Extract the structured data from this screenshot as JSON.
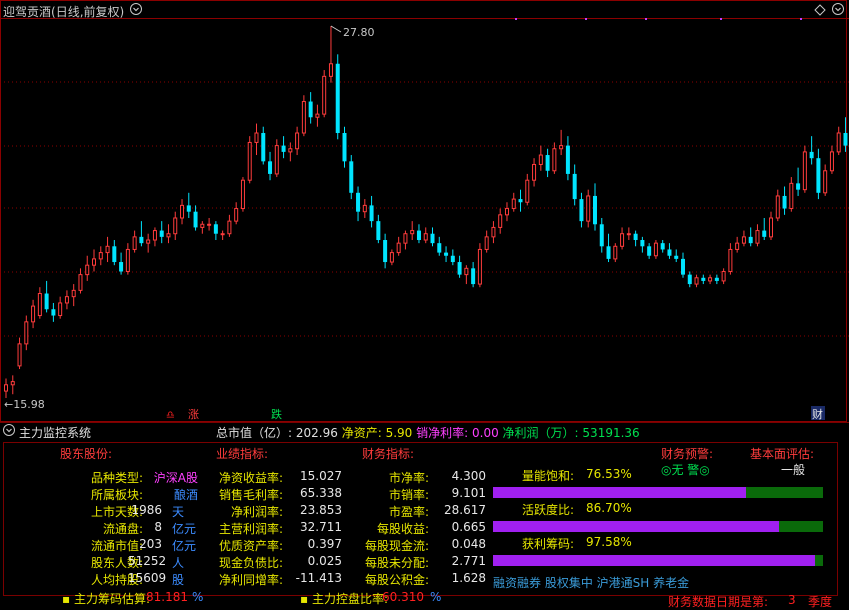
{
  "title": {
    "name": "迎驾贡酒",
    "mode": "(日线,前复权)"
  },
  "icons": {
    "dropdown": "chevron-down-icon",
    "diamond": "diamond-icon",
    "settings": "settings-icon"
  },
  "chart_data": {
    "type": "candlestick",
    "high_label": "27.80",
    "low_label": "15.98",
    "candles": [
      {
        "o": 16.2,
        "h": 16.6,
        "l": 15.98,
        "c": 16.4
      },
      {
        "o": 16.4,
        "h": 16.7,
        "l": 16.1,
        "c": 16.5
      },
      {
        "o": 17.0,
        "h": 17.9,
        "l": 16.9,
        "c": 17.7
      },
      {
        "o": 17.7,
        "h": 18.6,
        "l": 17.5,
        "c": 18.4
      },
      {
        "o": 18.4,
        "h": 19.1,
        "l": 18.2,
        "c": 18.9
      },
      {
        "o": 18.6,
        "h": 19.5,
        "l": 18.5,
        "c": 19.3
      },
      {
        "o": 19.3,
        "h": 19.7,
        "l": 18.7,
        "c": 18.8
      },
      {
        "o": 18.8,
        "h": 19.0,
        "l": 18.4,
        "c": 18.6
      },
      {
        "o": 18.6,
        "h": 19.2,
        "l": 18.5,
        "c": 19.0
      },
      {
        "o": 19.0,
        "h": 19.4,
        "l": 18.8,
        "c": 19.2
      },
      {
        "o": 19.2,
        "h": 19.6,
        "l": 18.9,
        "c": 19.4
      },
      {
        "o": 19.4,
        "h": 20.1,
        "l": 19.3,
        "c": 19.9
      },
      {
        "o": 19.9,
        "h": 20.5,
        "l": 19.7,
        "c": 20.2
      },
      {
        "o": 20.2,
        "h": 20.7,
        "l": 20.0,
        "c": 20.4
      },
      {
        "o": 20.4,
        "h": 20.8,
        "l": 20.2,
        "c": 20.6
      },
      {
        "o": 20.6,
        "h": 21.1,
        "l": 20.3,
        "c": 20.8
      },
      {
        "o": 20.8,
        "h": 21.0,
        "l": 20.2,
        "c": 20.3
      },
      {
        "o": 20.3,
        "h": 20.6,
        "l": 19.9,
        "c": 20.0
      },
      {
        "o": 20.0,
        "h": 20.9,
        "l": 19.9,
        "c": 20.7
      },
      {
        "o": 20.7,
        "h": 21.3,
        "l": 20.6,
        "c": 21.1
      },
      {
        "o": 21.1,
        "h": 21.6,
        "l": 20.8,
        "c": 20.9
      },
      {
        "o": 20.9,
        "h": 21.2,
        "l": 20.6,
        "c": 21.0
      },
      {
        "o": 21.0,
        "h": 21.4,
        "l": 20.8,
        "c": 21.3
      },
      {
        "o": 21.3,
        "h": 21.6,
        "l": 20.9,
        "c": 21.1
      },
      {
        "o": 21.1,
        "h": 21.5,
        "l": 20.9,
        "c": 21.2
      },
      {
        "o": 21.2,
        "h": 21.9,
        "l": 21.0,
        "c": 21.7
      },
      {
        "o": 21.7,
        "h": 22.3,
        "l": 21.5,
        "c": 22.1
      },
      {
        "o": 22.1,
        "h": 22.5,
        "l": 21.7,
        "c": 21.9
      },
      {
        "o": 21.9,
        "h": 22.1,
        "l": 21.3,
        "c": 21.4
      },
      {
        "o": 21.4,
        "h": 21.6,
        "l": 21.2,
        "c": 21.5
      },
      {
        "o": 21.5,
        "h": 21.7,
        "l": 21.3,
        "c": 21.5
      },
      {
        "o": 21.5,
        "h": 21.6,
        "l": 21.0,
        "c": 21.2
      },
      {
        "o": 21.2,
        "h": 21.3,
        "l": 21.0,
        "c": 21.2
      },
      {
        "o": 21.2,
        "h": 21.8,
        "l": 21.1,
        "c": 21.6
      },
      {
        "o": 21.6,
        "h": 22.2,
        "l": 21.5,
        "c": 22.0
      },
      {
        "o": 22.0,
        "h": 23.0,
        "l": 21.9,
        "c": 22.9
      },
      {
        "o": 22.9,
        "h": 24.3,
        "l": 22.8,
        "c": 24.1
      },
      {
        "o": 24.1,
        "h": 24.7,
        "l": 23.7,
        "c": 24.4
      },
      {
        "o": 24.4,
        "h": 24.6,
        "l": 23.4,
        "c": 23.5
      },
      {
        "o": 23.5,
        "h": 23.8,
        "l": 22.9,
        "c": 23.1
      },
      {
        "o": 23.1,
        "h": 24.2,
        "l": 23.0,
        "c": 24.0
      },
      {
        "o": 24.0,
        "h": 24.3,
        "l": 23.6,
        "c": 23.8
      },
      {
        "o": 23.8,
        "h": 24.1,
        "l": 23.5,
        "c": 23.9
      },
      {
        "o": 23.9,
        "h": 24.6,
        "l": 23.7,
        "c": 24.4
      },
      {
        "o": 24.4,
        "h": 25.6,
        "l": 24.3,
        "c": 25.4
      },
      {
        "o": 25.4,
        "h": 25.7,
        "l": 24.7,
        "c": 24.9
      },
      {
        "o": 24.9,
        "h": 25.3,
        "l": 24.6,
        "c": 25.0
      },
      {
        "o": 25.0,
        "h": 26.4,
        "l": 24.9,
        "c": 26.2
      },
      {
        "o": 26.2,
        "h": 27.8,
        "l": 26.0,
        "c": 26.6
      },
      {
        "o": 26.6,
        "h": 26.9,
        "l": 24.2,
        "c": 24.4
      },
      {
        "o": 24.4,
        "h": 24.6,
        "l": 23.3,
        "c": 23.5
      },
      {
        "o": 23.5,
        "h": 23.7,
        "l": 22.3,
        "c": 22.5
      },
      {
        "o": 22.5,
        "h": 22.7,
        "l": 21.6,
        "c": 21.9
      },
      {
        "o": 21.9,
        "h": 22.3,
        "l": 21.7,
        "c": 22.1
      },
      {
        "o": 22.1,
        "h": 22.4,
        "l": 21.4,
        "c": 21.6
      },
      {
        "o": 21.6,
        "h": 21.8,
        "l": 20.9,
        "c": 21.0
      },
      {
        "o": 21.0,
        "h": 21.2,
        "l": 20.1,
        "c": 20.3
      },
      {
        "o": 20.3,
        "h": 20.7,
        "l": 20.2,
        "c": 20.6
      },
      {
        "o": 20.6,
        "h": 21.1,
        "l": 20.5,
        "c": 20.9
      },
      {
        "o": 20.9,
        "h": 21.3,
        "l": 20.7,
        "c": 21.2
      },
      {
        "o": 21.2,
        "h": 21.6,
        "l": 21.0,
        "c": 21.3
      },
      {
        "o": 21.3,
        "h": 21.5,
        "l": 20.9,
        "c": 21.0
      },
      {
        "o": 21.0,
        "h": 21.4,
        "l": 20.9,
        "c": 21.2
      },
      {
        "o": 21.2,
        "h": 21.4,
        "l": 20.8,
        "c": 20.9
      },
      {
        "o": 20.9,
        "h": 21.1,
        "l": 20.5,
        "c": 20.6
      },
      {
        "o": 20.6,
        "h": 20.8,
        "l": 20.3,
        "c": 20.5
      },
      {
        "o": 20.5,
        "h": 20.7,
        "l": 20.2,
        "c": 20.3
      },
      {
        "o": 20.3,
        "h": 20.5,
        "l": 19.8,
        "c": 19.9
      },
      {
        "o": 19.9,
        "h": 20.2,
        "l": 19.6,
        "c": 20.1
      },
      {
        "o": 20.1,
        "h": 20.3,
        "l": 19.5,
        "c": 19.6
      },
      {
        "o": 19.6,
        "h": 20.9,
        "l": 19.5,
        "c": 20.7
      },
      {
        "o": 20.7,
        "h": 21.3,
        "l": 20.6,
        "c": 21.1
      },
      {
        "o": 21.1,
        "h": 21.6,
        "l": 20.9,
        "c": 21.4
      },
      {
        "o": 21.4,
        "h": 22.0,
        "l": 21.2,
        "c": 21.8
      },
      {
        "o": 21.8,
        "h": 22.2,
        "l": 21.6,
        "c": 22.0
      },
      {
        "o": 22.0,
        "h": 22.5,
        "l": 21.9,
        "c": 22.3
      },
      {
        "o": 22.3,
        "h": 22.6,
        "l": 21.9,
        "c": 22.2
      },
      {
        "o": 22.2,
        "h": 23.1,
        "l": 22.1,
        "c": 22.9
      },
      {
        "o": 22.9,
        "h": 23.6,
        "l": 22.7,
        "c": 23.4
      },
      {
        "o": 23.4,
        "h": 24.0,
        "l": 23.2,
        "c": 23.7
      },
      {
        "o": 23.7,
        "h": 23.9,
        "l": 23.0,
        "c": 23.2
      },
      {
        "o": 23.2,
        "h": 24.1,
        "l": 23.1,
        "c": 23.9
      },
      {
        "o": 23.9,
        "h": 24.5,
        "l": 23.7,
        "c": 24.0
      },
      {
        "o": 24.0,
        "h": 24.3,
        "l": 22.9,
        "c": 23.1
      },
      {
        "o": 23.1,
        "h": 23.4,
        "l": 22.1,
        "c": 22.3
      },
      {
        "o": 22.3,
        "h": 22.5,
        "l": 21.4,
        "c": 21.6
      },
      {
        "o": 21.6,
        "h": 22.6,
        "l": 21.4,
        "c": 22.4
      },
      {
        "o": 22.4,
        "h": 22.8,
        "l": 21.3,
        "c": 21.5
      },
      {
        "o": 21.5,
        "h": 21.7,
        "l": 20.6,
        "c": 20.8
      },
      {
        "o": 20.8,
        "h": 21.2,
        "l": 20.3,
        "c": 20.4
      },
      {
        "o": 20.4,
        "h": 20.9,
        "l": 20.3,
        "c": 20.8
      },
      {
        "o": 20.8,
        "h": 21.4,
        "l": 20.7,
        "c": 21.2
      },
      {
        "o": 21.2,
        "h": 21.4,
        "l": 21.0,
        "c": 21.2
      },
      {
        "o": 21.2,
        "h": 21.3,
        "l": 20.8,
        "c": 21.0
      },
      {
        "o": 21.0,
        "h": 21.1,
        "l": 20.6,
        "c": 20.8
      },
      {
        "o": 20.8,
        "h": 20.9,
        "l": 20.4,
        "c": 20.5
      },
      {
        "o": 20.5,
        "h": 21.0,
        "l": 20.4,
        "c": 20.9
      },
      {
        "o": 20.9,
        "h": 21.0,
        "l": 20.6,
        "c": 20.7
      },
      {
        "o": 20.7,
        "h": 20.9,
        "l": 20.4,
        "c": 20.5
      },
      {
        "o": 20.5,
        "h": 20.7,
        "l": 20.3,
        "c": 20.4
      },
      {
        "o": 20.4,
        "h": 20.6,
        "l": 19.8,
        "c": 19.9
      },
      {
        "o": 19.9,
        "h": 20.0,
        "l": 19.5,
        "c": 19.6
      },
      {
        "o": 19.6,
        "h": 19.9,
        "l": 19.5,
        "c": 19.8
      },
      {
        "o": 19.8,
        "h": 19.9,
        "l": 19.6,
        "c": 19.7
      },
      {
        "o": 19.7,
        "h": 19.9,
        "l": 19.6,
        "c": 19.8
      },
      {
        "o": 19.8,
        "h": 19.9,
        "l": 19.6,
        "c": 19.7
      },
      {
        "o": 19.7,
        "h": 20.1,
        "l": 19.6,
        "c": 20.0
      },
      {
        "o": 20.0,
        "h": 20.9,
        "l": 19.9,
        "c": 20.7
      },
      {
        "o": 20.7,
        "h": 21.1,
        "l": 20.6,
        "c": 20.9
      },
      {
        "o": 20.9,
        "h": 21.3,
        "l": 20.8,
        "c": 21.1
      },
      {
        "o": 21.1,
        "h": 21.4,
        "l": 20.8,
        "c": 20.9
      },
      {
        "o": 20.9,
        "h": 21.5,
        "l": 20.8,
        "c": 21.3
      },
      {
        "o": 21.3,
        "h": 21.7,
        "l": 21.0,
        "c": 21.1
      },
      {
        "o": 21.1,
        "h": 21.9,
        "l": 21.0,
        "c": 21.7
      },
      {
        "o": 21.7,
        "h": 22.6,
        "l": 21.6,
        "c": 22.4
      },
      {
        "o": 22.4,
        "h": 22.7,
        "l": 21.8,
        "c": 22.0
      },
      {
        "o": 22.0,
        "h": 23.0,
        "l": 21.9,
        "c": 22.8
      },
      {
        "o": 22.8,
        "h": 23.3,
        "l": 22.4,
        "c": 22.6
      },
      {
        "o": 22.6,
        "h": 24.0,
        "l": 22.5,
        "c": 23.8
      },
      {
        "o": 23.8,
        "h": 24.3,
        "l": 23.4,
        "c": 23.6
      },
      {
        "o": 23.6,
        "h": 23.9,
        "l": 22.3,
        "c": 22.5
      },
      {
        "o": 22.5,
        "h": 23.4,
        "l": 22.4,
        "c": 23.2
      },
      {
        "o": 23.2,
        "h": 24.0,
        "l": 23.1,
        "c": 23.8
      },
      {
        "o": 23.8,
        "h": 24.6,
        "l": 23.7,
        "c": 24.4
      },
      {
        "o": 24.4,
        "h": 24.9,
        "l": 23.8,
        "c": 24.0
      },
      {
        "o": 24.0,
        "h": 24.3,
        "l": 23.0,
        "c": 23.2
      },
      {
        "o": 23.2,
        "h": 25.4,
        "l": 23.1,
        "c": 25.2
      }
    ],
    "markers": {
      "zhang": "涨",
      "die": "跌",
      "cai": "财",
      "red_symbol": "♎"
    }
  },
  "summary": {
    "mcap_label": "总市值（亿）:",
    "mcap_value": "202.96",
    "net_assets_label": "净资产:",
    "net_assets_value": "5.90",
    "net_margin_label": "销净利率:",
    "net_margin_value": "0.00",
    "net_profit_label": "净利润（万）:",
    "net_profit_value": "53191.36"
  },
  "monitor": {
    "title": "主力监控系统",
    "headers": {
      "shareholders": "股东股份:",
      "industry": "业绩指标:",
      "finance": "财务指标:",
      "warning": "财务预警:",
      "fundamental": "基本面评估:"
    },
    "col1": [
      {
        "label": "品种类型:",
        "value": "沪深A股",
        "unit": ""
      },
      {
        "label": "所属板块:",
        "value": "酿酒",
        "unit": ""
      },
      {
        "label": "上市天数:",
        "value": "1986",
        "unit": "天"
      },
      {
        "label": "流通盘:",
        "value": "8",
        "unit": "亿元"
      },
      {
        "label": "流通市值:",
        "value": "203",
        "unit": "亿元"
      },
      {
        "label": "股东人数:",
        "value": "51252",
        "unit": "人"
      },
      {
        "label": "人均持股:",
        "value": "15609",
        "unit": "股"
      }
    ],
    "col2": [
      {
        "label": "净资收益率:",
        "value": "15.027"
      },
      {
        "label": "销售毛利率:",
        "value": "65.338"
      },
      {
        "label": "净利润率:",
        "value": "23.853"
      },
      {
        "label": "主营利润率:",
        "value": "32.711"
      },
      {
        "label": "优质资产率:",
        "value": "0.397"
      },
      {
        "label": "现金负债比:",
        "value": "0.025"
      },
      {
        "label": "净利同增率:",
        "value": "-11.413"
      }
    ],
    "col3": [
      {
        "label": "市净率:",
        "value": "4.300"
      },
      {
        "label": "市销率:",
        "value": "9.101"
      },
      {
        "label": "市盈率:",
        "value": "28.617"
      },
      {
        "label": "每股收益:",
        "value": "0.665"
      },
      {
        "label": "每股现金流:",
        "value": "0.048"
      },
      {
        "label": "每股未分配:",
        "value": "2.771"
      },
      {
        "label": "每股公积金:",
        "value": "1.628"
      }
    ],
    "warning_value": "◎无 警◎",
    "fundamental_value": "一般",
    "metrics": [
      {
        "label": "量能饱和:",
        "value": "76.53%",
        "fraction": 0.7653
      },
      {
        "label": "活跃度比:",
        "value": "86.70%",
        "fraction": 0.867
      },
      {
        "label": "获利筹码:",
        "value": "97.58%",
        "fraction": 0.9758
      }
    ],
    "tags": "融资融券 股权集中 沪港通SH 养老金",
    "bottom": {
      "chip_label": "主力筹码估算:",
      "chip_value": "81.181",
      "chip_unit": "%",
      "control_label": "主力控盘比率:",
      "control_value": "60.310",
      "control_unit": "%",
      "report_label": "财务数据日期是第:",
      "report_value": "3",
      "report_unit": "季度"
    }
  },
  "colors": {
    "up": "#ff3c3c",
    "down": "#00e5ff",
    "grid": "#8b0000",
    "bar_fill": "#a020f0",
    "bar_bg": "#0a6a0a"
  }
}
